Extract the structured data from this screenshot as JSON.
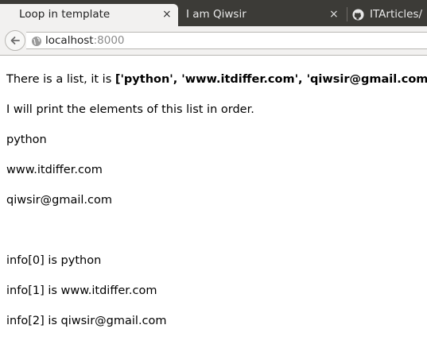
{
  "browser": {
    "tabs": [
      {
        "title": "Loop in template",
        "close": "×",
        "active": true
      },
      {
        "title": "I am Qiwsir",
        "close": "×",
        "active": false
      },
      {
        "title": "ITArticles/",
        "active": false
      }
    ],
    "address": {
      "host": "localhost",
      "port": ":8000"
    },
    "icons": {
      "back": "back-arrow-icon",
      "site": "globe-icon",
      "tab3": "github-icon"
    }
  },
  "page": {
    "intro_prefix": "There is a list, it is ",
    "intro_list": "['python', 'www.itdiffer.com', 'qiwsir@gmail.com']",
    "order_line": "I will print the elements of this list in order.",
    "elements": [
      "python",
      "www.itdiffer.com",
      "qiwsir@gmail.com"
    ],
    "indexed": [
      "info[0] is python",
      "info[1] is www.itdiffer.com",
      "info[2] is qiwsir@gmail.com"
    ]
  }
}
